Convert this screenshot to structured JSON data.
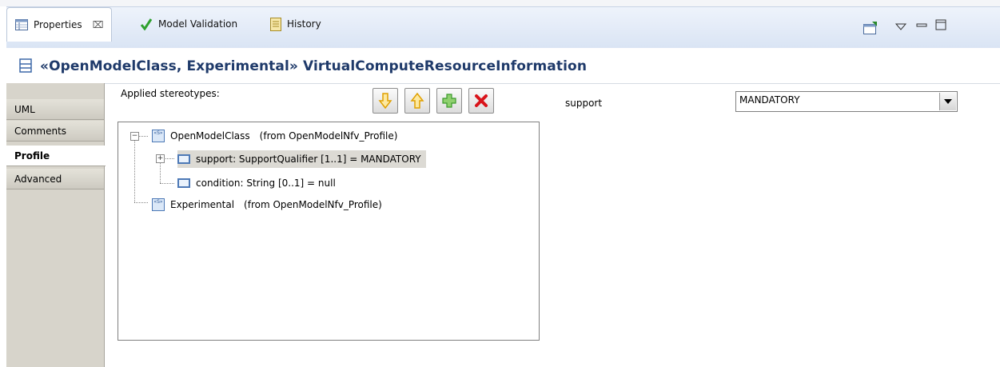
{
  "tabs": {
    "properties": "Properties",
    "properties_close": "⌧",
    "model_validation": "Model Validation",
    "history": "History"
  },
  "header": {
    "title": "«OpenModelClass, Experimental» VirtualComputeResourceInformation"
  },
  "sections": {
    "uml": "UML",
    "comments": "Comments",
    "profile": "Profile",
    "advanced": "Advanced"
  },
  "profile": {
    "applied_label": "Applied stereotypes:",
    "tree": {
      "stereotype1_name": "OpenModelClass",
      "stereotype1_from": "(from OpenModelNfv_Profile)",
      "prop_support": "support: SupportQualifier [1..1] = MANDATORY",
      "prop_condition": "condition: String [0..1] = null",
      "stereotype2_name": "Experimental",
      "stereotype2_from": "(from OpenModelNfv_Profile)"
    },
    "property_label": "support",
    "property_value": "MANDATORY"
  },
  "colors": {
    "move_down": "#f0b400",
    "move_up": "#f0b400",
    "add": "#43a82e",
    "remove": "#d9141b"
  },
  "icons": {
    "move_down": "arrow-down-icon",
    "move_up": "arrow-up-icon",
    "add": "plus-icon",
    "remove": "x-icon"
  }
}
